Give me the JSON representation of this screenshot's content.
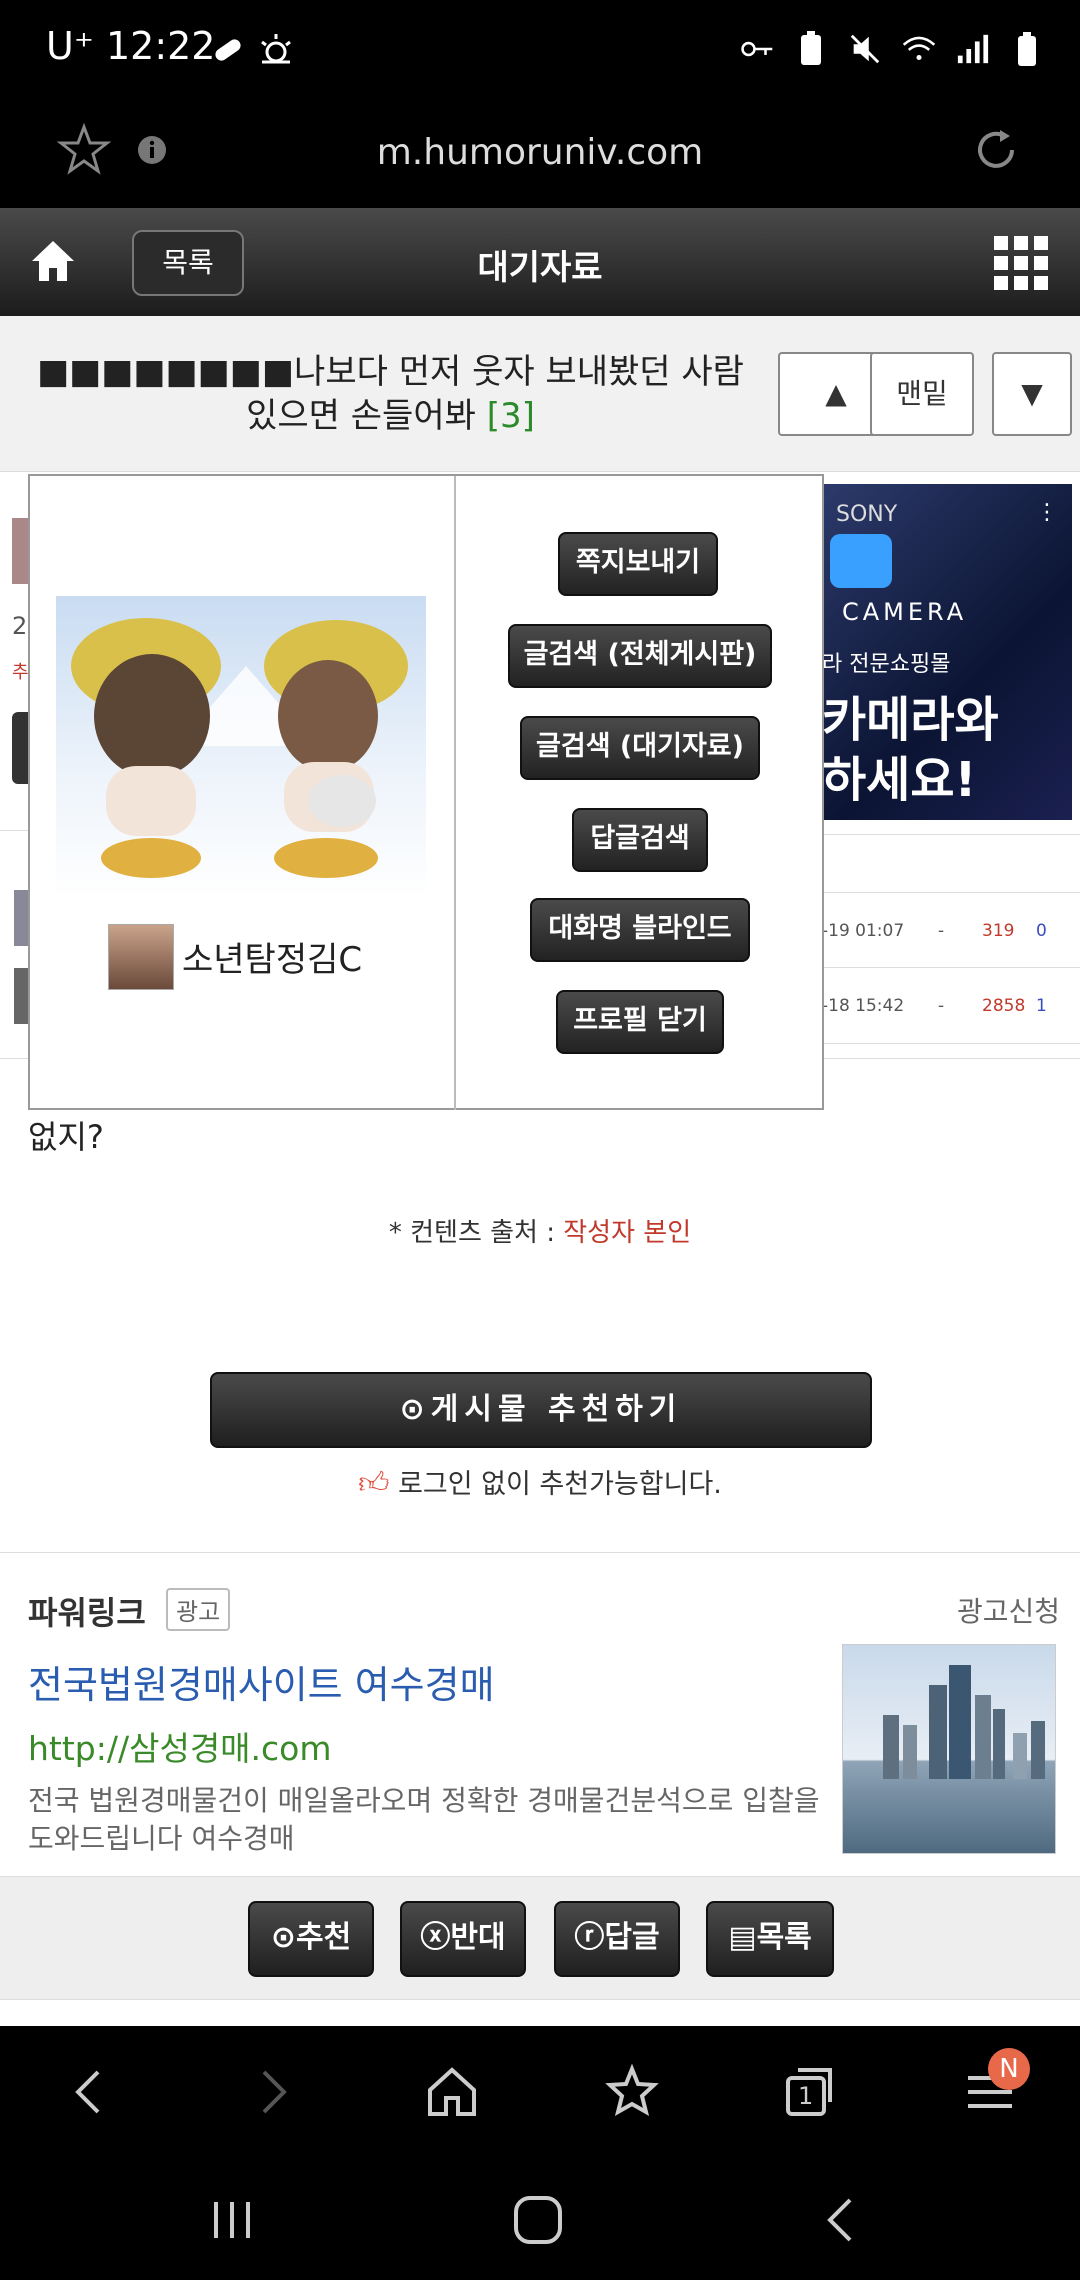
{
  "status_bar": {
    "carrier": "U⁺",
    "time": "12:22"
  },
  "url_bar": {
    "url": "m.humoruniv.com"
  },
  "site_header": {
    "list_button": "목록",
    "board_title": "대기자료"
  },
  "post": {
    "title": "■■■■■■■■나보다 먼저 웃자 보내봤던 사람 있으면 손들어봐",
    "comment_count": "[3]",
    "nav_up": "▲",
    "nav_bottom": "맨밑",
    "nav_down": "▼",
    "body_text": "없지?",
    "source_label": "* 컨텐츠 출처 :",
    "source_value": "작성자 본인",
    "recommend_button": "⊙게시물 추천하기",
    "login_note": "로그인 없이 추천가능합니다."
  },
  "background_list": {
    "rows": [
      {
        "date": "-19 01:07",
        "dash": "-",
        "views": "319",
        "recs": "0"
      },
      {
        "date": "-18 15:42",
        "dash": "-",
        "views": "2858",
        "recs": "1"
      }
    ]
  },
  "ad_banner": {
    "brand": "SONY",
    "line1": "CAMERA",
    "line2": "라 전문쇼핑몰",
    "line3": "카메라와",
    "line4": "하세요!"
  },
  "profile_popup": {
    "nickname": "소년탐정김C",
    "buttons": [
      "쪽지보내기",
      "글검색 (전체게시판)",
      "글검색 (대기자료)",
      "답글검색",
      "대화명 블라인드",
      "프로필 닫기"
    ]
  },
  "power_link": {
    "label": "파워링크",
    "ad_tag": "광고",
    "apply": "광고신청",
    "title": "전국법원경매사이트 여수경매",
    "url": "http://삼성경매.com",
    "description": "전국 법원경매물건이 매일올라오며 정확한 경매물건분석으로 입찰을도와드립니다 여수경매"
  },
  "action_bar": {
    "recommend": "⊙추천",
    "oppose": "ⓧ반대",
    "reply": "ⓡ답글",
    "list": "▤목록"
  },
  "browser_nav": {
    "tab_count": "1",
    "notification_badge": "N"
  }
}
